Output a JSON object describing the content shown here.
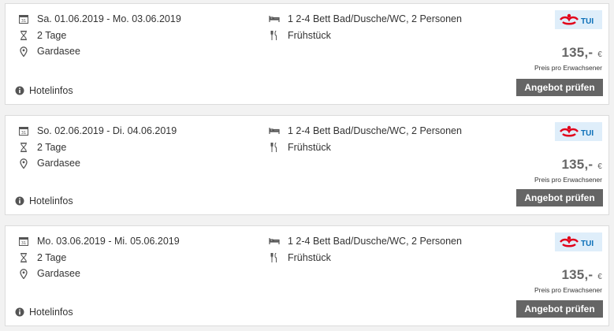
{
  "offers": [
    {
      "date_range": "Sa. 01.06.2019 - Mo. 03.06.2019",
      "duration": "2 Tage",
      "location": "Gardasee",
      "room": "1 2-4 Bett Bad/Dusche/WC, 2 Personen",
      "board": "Frühstück",
      "hotel_info_label": "Hotelinfos",
      "operator": "TUI",
      "price": "135,-",
      "currency": "€",
      "price_note": "Preis pro Erwachsener",
      "cta_label": "Angebot prüfen"
    },
    {
      "date_range": "So. 02.06.2019 - Di. 04.06.2019",
      "duration": "2 Tage",
      "location": "Gardasee",
      "room": "1 2-4 Bett Bad/Dusche/WC, 2 Personen",
      "board": "Frühstück",
      "hotel_info_label": "Hotelinfos",
      "operator": "TUI",
      "price": "135,-",
      "currency": "€",
      "price_note": "Preis pro Erwachsener",
      "cta_label": "Angebot prüfen"
    },
    {
      "date_range": "Mo. 03.06.2019 - Mi. 05.06.2019",
      "duration": "2 Tage",
      "location": "Gardasee",
      "room": "1 2-4 Bett Bad/Dusche/WC, 2 Personen",
      "board": "Frühstück",
      "hotel_info_label": "Hotelinfos",
      "operator": "TUI",
      "price": "135,-",
      "currency": "€",
      "price_note": "Preis pro Erwachsener",
      "cta_label": "Angebot prüfen"
    }
  ],
  "icons": {
    "date": "calendar-icon",
    "duration": "hourglass-icon",
    "location": "map-pin-icon",
    "room": "bed-icon",
    "board": "cutlery-icon",
    "info": "info-icon"
  },
  "colors": {
    "button_bg": "#656565",
    "tui_red": "#e2001a",
    "tui_blue": "#0b6fb8",
    "tui_bg": "#dfeefa"
  }
}
